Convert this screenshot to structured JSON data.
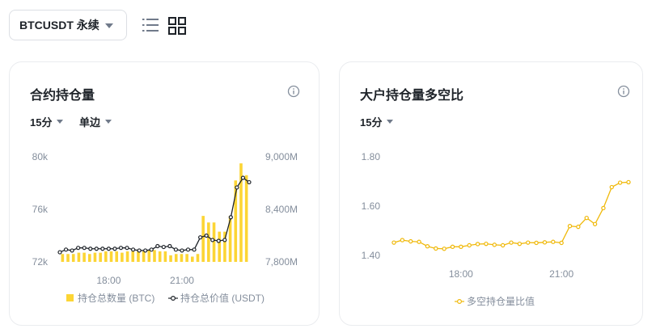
{
  "header": {
    "symbol_label": "BTCUSDT 永续",
    "icons": [
      "list-view-icon",
      "grid-view-icon"
    ]
  },
  "colors": {
    "accent": "#f0b90b",
    "accent_light": "#fcd535",
    "line_dark": "#1e2329",
    "tick": "#848e9c"
  },
  "cards": {
    "left": {
      "title": "合约持仓量",
      "period": "15分",
      "mode": "单边"
    },
    "right": {
      "title": "大户持仓量多空比",
      "period": "15分"
    }
  },
  "chart_data": [
    {
      "type": "bar",
      "title": "合约持仓量",
      "x_tick_labels": [
        "18:00",
        "21:00"
      ],
      "x_tick_index": [
        8,
        20
      ],
      "left_axis": {
        "ticks": [
          "80k",
          "76k",
          "72k"
        ],
        "ylim": [
          72000,
          80000
        ]
      },
      "right_axis": {
        "ticks": [
          "9,000M",
          "8,400M",
          "7,800M"
        ],
        "ylim": [
          7800,
          9000
        ]
      },
      "grid": false,
      "legend": "bottom",
      "series": [
        {
          "name": "持仓总数量 (BTC)",
          "kind": "bar",
          "axis": "left",
          "values": [
            72600,
            72600,
            72600,
            72700,
            72700,
            72600,
            72700,
            72700,
            72800,
            72800,
            72800,
            72700,
            72800,
            72800,
            72800,
            72800,
            72900,
            72900,
            72800,
            72800,
            72500,
            72600,
            72600,
            72600,
            72400,
            72600,
            75500,
            75000,
            75000,
            74300,
            74300,
            75500,
            78200,
            79500,
            78600
          ]
        },
        {
          "name": "持仓总价值 (USDT)",
          "kind": "line",
          "axis": "right",
          "values": [
            7910,
            7940,
            7930,
            7960,
            7960,
            7950,
            7950,
            7950,
            7950,
            7950,
            7960,
            7960,
            7940,
            7930,
            7930,
            7940,
            7980,
            7970,
            7980,
            7940,
            7930,
            7940,
            7940,
            8080,
            8100,
            8050,
            8040,
            8050,
            8310,
            8650,
            8760,
            8710
          ]
        }
      ]
    },
    {
      "type": "line",
      "title": "大户持仓量多空比",
      "x_tick_labels": [
        "18:00",
        "21:00"
      ],
      "x_tick_index": [
        8,
        20
      ],
      "y_axis": {
        "ticks": [
          "1.80",
          "1.60",
          "1.40"
        ],
        "ylim": [
          1.4,
          1.8
        ]
      },
      "grid": false,
      "legend": "bottom",
      "series": [
        {
          "name": "多空持仓量比值",
          "values": [
            1.452,
            1.462,
            1.457,
            1.455,
            1.437,
            1.428,
            1.427,
            1.435,
            1.435,
            1.441,
            1.446,
            1.447,
            1.443,
            1.441,
            1.452,
            1.447,
            1.452,
            1.451,
            1.453,
            1.455,
            1.451,
            1.519,
            1.516,
            1.552,
            1.527,
            1.592,
            1.677,
            1.695,
            1.697
          ]
        }
      ]
    }
  ]
}
